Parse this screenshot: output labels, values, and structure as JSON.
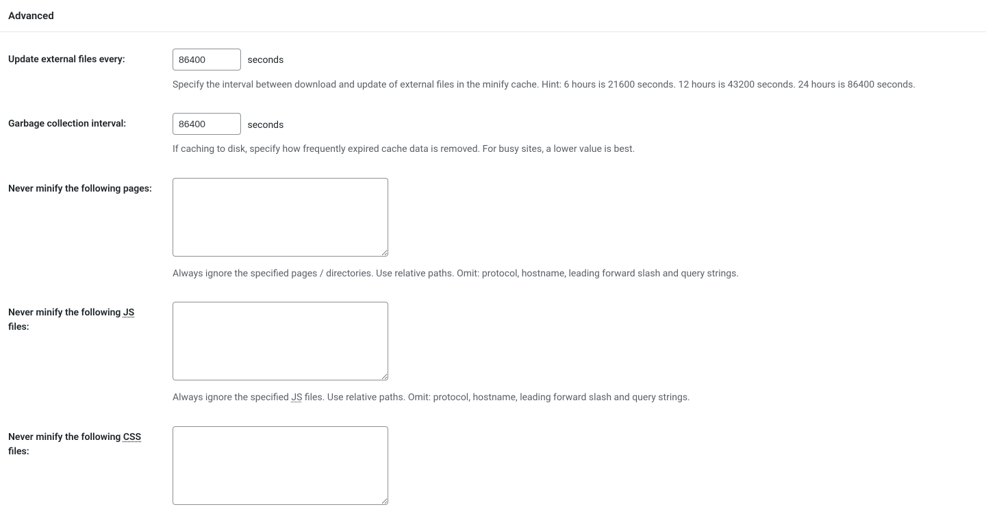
{
  "section_title": "Advanced",
  "fields": {
    "update_external": {
      "label": "Update external files every:",
      "value": "86400",
      "unit": "seconds",
      "description": "Specify the interval between download and update of external files in the minify cache. Hint: 6 hours is 21600 seconds. 12 hours is 43200 seconds. 24 hours is 86400 seconds."
    },
    "garbage_interval": {
      "label": "Garbage collection interval:",
      "value": "86400",
      "unit": "seconds",
      "description": "If caching to disk, specify how frequently expired cache data is removed. For busy sites, a lower value is best."
    },
    "never_minify_pages": {
      "label": "Never minify the following pages:",
      "value": "",
      "description": "Always ignore the specified pages / directories. Use relative paths. Omit: protocol, hostname, leading forward slash and query strings."
    },
    "never_minify_js": {
      "label_pre": "Never minify the following ",
      "label_abbr": "JS",
      "label_post": " files:",
      "value": "",
      "description_pre": "Always ignore the specified ",
      "description_abbr": "JS",
      "description_post": " files. Use relative paths. Omit: protocol, hostname, leading forward slash and query strings."
    },
    "never_minify_css": {
      "label_pre": "Never minify the following ",
      "label_abbr": "CSS",
      "label_post": " files:",
      "value": ""
    }
  }
}
